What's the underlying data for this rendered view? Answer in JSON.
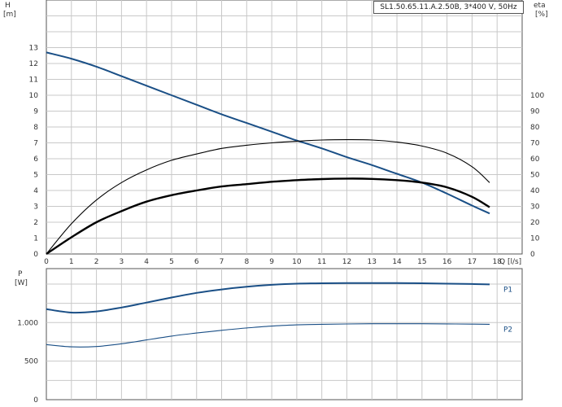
{
  "chart_data": [
    {
      "type": "line",
      "title": "SL1.50.65.11.A.2.50B, 3*400 V, 50Hz",
      "xlabel": "Q [l/s]",
      "ylabel": "H [m]",
      "y2label": "eta [%]",
      "xlim": [
        0,
        19
      ],
      "xticks": [
        0,
        1,
        2,
        3,
        4,
        5,
        6,
        7,
        8,
        9,
        10,
        11,
        12,
        13,
        14,
        15,
        16,
        17,
        18
      ],
      "ylim": [
        0,
        16
      ],
      "yticks": [
        0,
        1,
        2,
        3,
        4,
        5,
        6,
        7,
        8,
        9,
        10,
        11,
        12,
        13
      ],
      "y2lim": [
        0,
        160
      ],
      "y2ticks": [
        0,
        10,
        20,
        30,
        40,
        50,
        60,
        70,
        80,
        90,
        100
      ],
      "grid": true,
      "series": [
        {
          "axis": "H",
          "color": "#1a4f86",
          "x": [
            0,
            1,
            2,
            3,
            4,
            5,
            6,
            7,
            8,
            9,
            10,
            11,
            12,
            13,
            14,
            15,
            16,
            17,
            17.7
          ],
          "y": [
            12.7,
            12.3,
            11.8,
            11.2,
            10.6,
            10.0,
            9.4,
            8.8,
            8.25,
            7.7,
            7.15,
            6.65,
            6.1,
            5.6,
            5.05,
            4.5,
            3.8,
            3.05,
            2.55
          ]
        },
        {
          "axis": "eta",
          "color": "#000000",
          "x": [
            0,
            1,
            2,
            3,
            4,
            5,
            6,
            7,
            8,
            9,
            10,
            11,
            12,
            13,
            14,
            15,
            16,
            17,
            17.7
          ],
          "y": [
            0,
            19,
            34,
            45,
            53,
            59,
            63,
            66.5,
            68.5,
            70,
            71,
            71.8,
            72,
            71.8,
            70.5,
            68,
            63.5,
            55,
            45
          ]
        },
        {
          "axis": "eta",
          "color": "#000000",
          "x": [
            0,
            1,
            2,
            3,
            4,
            5,
            6,
            7,
            8,
            9,
            10,
            11,
            12,
            13,
            14,
            15,
            16,
            17,
            17.7
          ],
          "y": [
            0,
            10.5,
            20,
            27,
            33,
            37,
            40,
            42.5,
            44,
            45.5,
            46.5,
            47.2,
            47.5,
            47.3,
            46.5,
            45,
            42,
            36,
            29.5
          ]
        }
      ]
    },
    {
      "type": "line",
      "xlabel": "",
      "ylabel": "P [W]",
      "xlim": [
        0,
        19
      ],
      "ylim": [
        0,
        1700
      ],
      "yticks": [
        0,
        500,
        1000
      ],
      "yticklabels": [
        "0",
        "500",
        "1.000"
      ],
      "grid": true,
      "series": [
        {
          "name": "P1",
          "color": "#1a4f86",
          "x": [
            0,
            1,
            2,
            3,
            4,
            5,
            6,
            7,
            8,
            9,
            10,
            11,
            12,
            13,
            14,
            15,
            16,
            17,
            17.7
          ],
          "y": [
            1175,
            1130,
            1145,
            1195,
            1260,
            1325,
            1385,
            1430,
            1465,
            1490,
            1505,
            1510,
            1512,
            1513,
            1512,
            1510,
            1505,
            1500,
            1495
          ]
        },
        {
          "name": "P2",
          "color": "#1a4f86",
          "x": [
            0,
            1,
            2,
            3,
            4,
            5,
            6,
            7,
            8,
            9,
            10,
            11,
            12,
            13,
            14,
            15,
            16,
            17,
            17.7
          ],
          "y": [
            715,
            685,
            690,
            725,
            775,
            825,
            865,
            900,
            930,
            955,
            970,
            978,
            982,
            985,
            985,
            985,
            983,
            980,
            978
          ]
        }
      ]
    }
  ]
}
